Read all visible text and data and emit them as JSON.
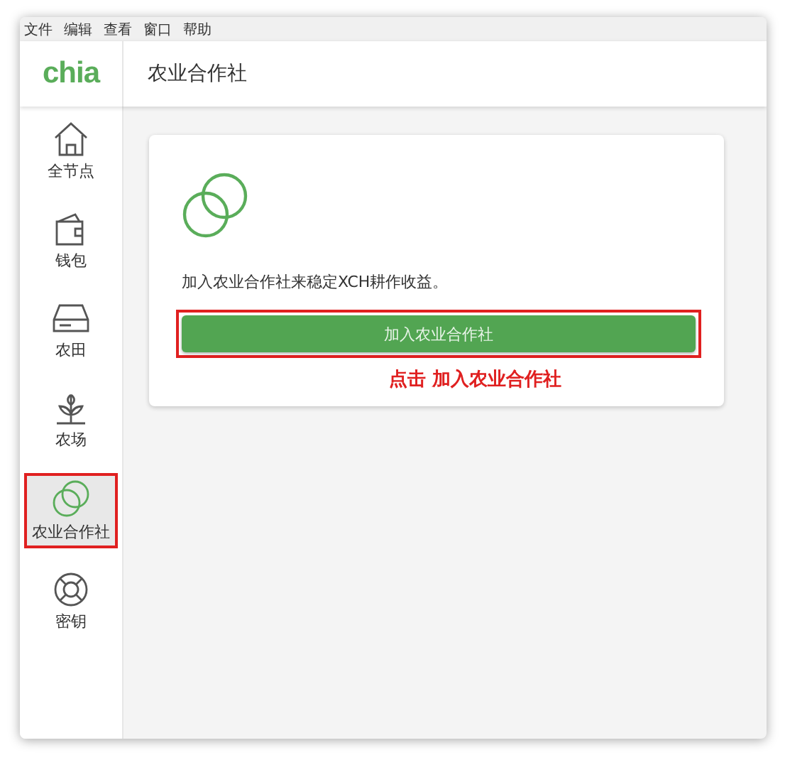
{
  "menu_bar": [
    "文件",
    "编辑",
    "查看",
    "窗口",
    "帮助"
  ],
  "logo": "chia",
  "header": {
    "title": "农业合作社"
  },
  "sidebar": {
    "items": [
      {
        "label": "全节点",
        "selected": false,
        "highlighted": false
      },
      {
        "label": "钱包",
        "selected": false,
        "highlighted": false
      },
      {
        "label": "农田",
        "selected": false,
        "highlighted": false
      },
      {
        "label": "农场",
        "selected": false,
        "highlighted": false
      },
      {
        "label": "农业合作社",
        "selected": true,
        "highlighted": true
      },
      {
        "label": "密钥",
        "selected": false,
        "highlighted": false
      }
    ]
  },
  "card": {
    "description": "加入农业合作社来稳定XCH耕作收益。",
    "button": {
      "label": "加入农业合作社",
      "highlighted": true
    },
    "annotation": "点击 加入农业合作社"
  }
}
